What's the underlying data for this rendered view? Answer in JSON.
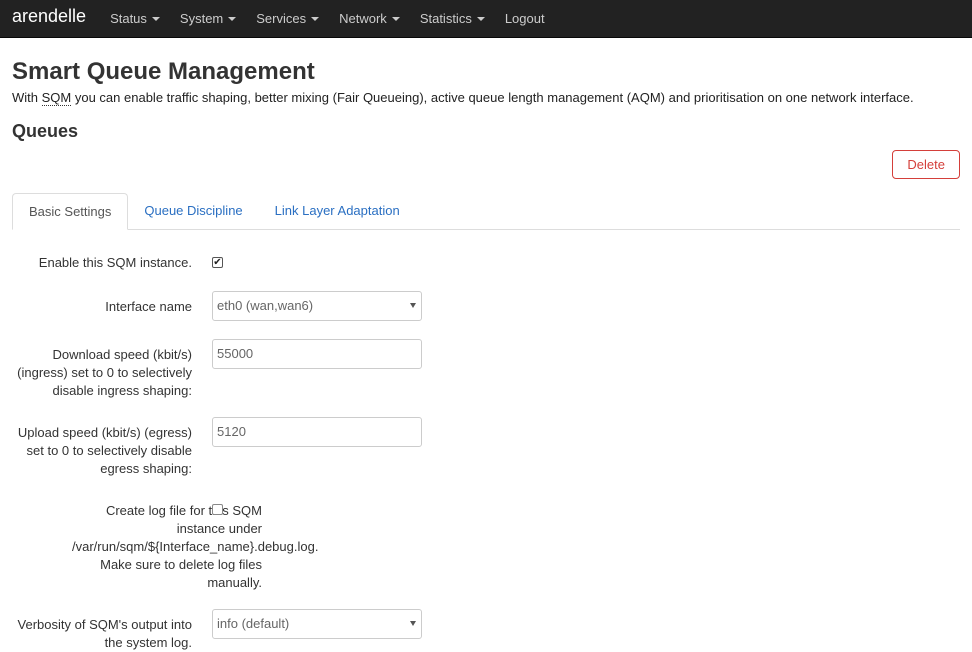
{
  "navbar": {
    "brand": "arendelle",
    "items": [
      {
        "label": "Status"
      },
      {
        "label": "System"
      },
      {
        "label": "Services"
      },
      {
        "label": "Network"
      },
      {
        "label": "Statistics"
      },
      {
        "label": "Logout"
      }
    ]
  },
  "page": {
    "title": "Smart Queue Management",
    "desc_prefix": "With ",
    "desc_abbr": "SQM",
    "desc_suffix": " you can enable traffic shaping, better mixing (Fair Queueing), active queue length management (AQM) and prioritisation on one network interface.",
    "section_title": "Queues",
    "delete_label": "Delete"
  },
  "tabs": [
    {
      "label": "Basic Settings",
      "active": true
    },
    {
      "label": "Queue Discipline",
      "active": false
    },
    {
      "label": "Link Layer Adaptation",
      "active": false
    }
  ],
  "form": {
    "enable_label": "Enable this SQM instance.",
    "enable_checked": true,
    "interface_label": "Interface name",
    "interface_value": "eth0 (wan,wan6)",
    "download_label": "Download speed (kbit/s) (ingress) set to 0 to selectively disable ingress shaping:",
    "download_value": "55000",
    "upload_label": "Upload speed (kbit/s) (egress) set to 0 to selectively disable egress shaping:",
    "upload_value": "5120",
    "log_label": "Create log file for this SQM instance under /var/run/sqm/${Interface_name}.debug.log. Make sure to delete log files manually.",
    "log_checked": false,
    "verbosity_label": "Verbosity of SQM's output into the system log.",
    "verbosity_value": "info (default)"
  }
}
